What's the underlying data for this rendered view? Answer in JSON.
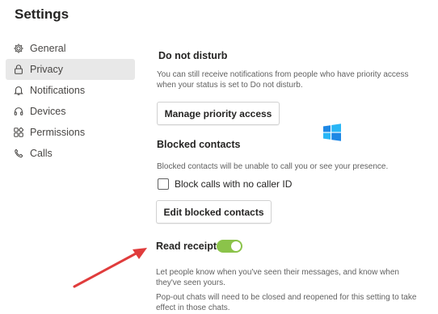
{
  "header": {
    "title": "Settings"
  },
  "sidebar": {
    "items": [
      {
        "label": "General",
        "icon": "gear-icon",
        "active": false
      },
      {
        "label": "Privacy",
        "icon": "lock-icon",
        "active": true
      },
      {
        "label": "Notifications",
        "icon": "bell-icon",
        "active": false
      },
      {
        "label": "Devices",
        "icon": "headset-icon",
        "active": false
      },
      {
        "label": "Permissions",
        "icon": "apps-icon",
        "active": false
      },
      {
        "label": "Calls",
        "icon": "phone-icon",
        "active": false
      }
    ]
  },
  "dnd": {
    "title": "Do not disturb",
    "desc": "You can still receive notifications from people who have priority access when your status is set to Do not disturb.",
    "button": "Manage priority access"
  },
  "blocked": {
    "title": "Blocked contacts",
    "desc": "Blocked contacts will be unable to call you or see your presence.",
    "checkbox_label": "Block calls with no caller ID",
    "checkbox_checked": false,
    "button": "Edit blocked contacts"
  },
  "receipts": {
    "title": "Read receipts",
    "toggle_on": true,
    "desc1": "Let people know when you've seen their messages, and know when they've seen yours.",
    "desc2": "Pop-out chats will need to be closed and reopened for this setting to take effect in those chats."
  },
  "colors": {
    "toggle_on": "#8bc34a",
    "active_nav_bg": "#e8e8e8",
    "arrow": "#e03c3c"
  }
}
